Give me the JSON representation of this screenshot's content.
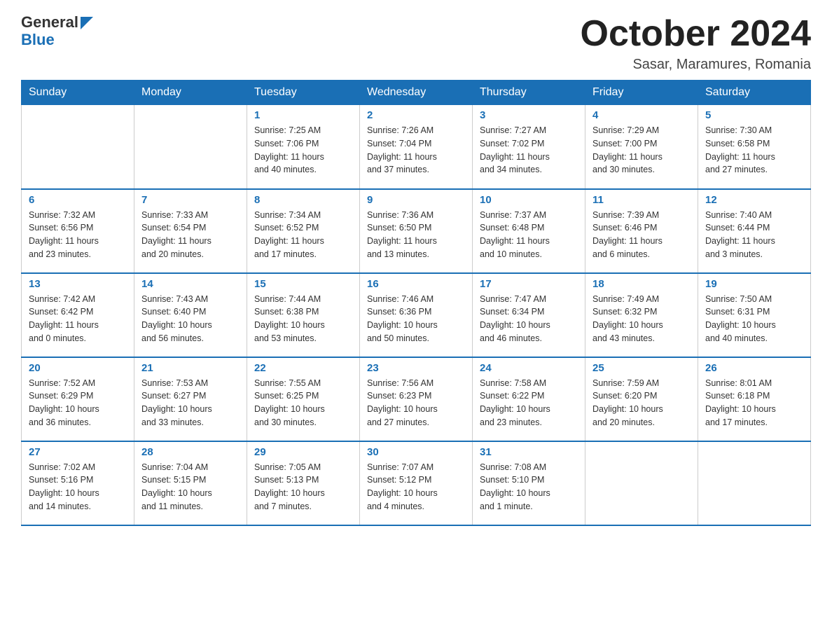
{
  "header": {
    "logo_line1": "General",
    "logo_line2": "Blue",
    "month_title": "October 2024",
    "location": "Sasar, Maramures, Romania"
  },
  "weekdays": [
    "Sunday",
    "Monday",
    "Tuesday",
    "Wednesday",
    "Thursday",
    "Friday",
    "Saturday"
  ],
  "weeks": [
    [
      {
        "day": "",
        "info": ""
      },
      {
        "day": "",
        "info": ""
      },
      {
        "day": "1",
        "info": "Sunrise: 7:25 AM\nSunset: 7:06 PM\nDaylight: 11 hours\nand 40 minutes."
      },
      {
        "day": "2",
        "info": "Sunrise: 7:26 AM\nSunset: 7:04 PM\nDaylight: 11 hours\nand 37 minutes."
      },
      {
        "day": "3",
        "info": "Sunrise: 7:27 AM\nSunset: 7:02 PM\nDaylight: 11 hours\nand 34 minutes."
      },
      {
        "day": "4",
        "info": "Sunrise: 7:29 AM\nSunset: 7:00 PM\nDaylight: 11 hours\nand 30 minutes."
      },
      {
        "day": "5",
        "info": "Sunrise: 7:30 AM\nSunset: 6:58 PM\nDaylight: 11 hours\nand 27 minutes."
      }
    ],
    [
      {
        "day": "6",
        "info": "Sunrise: 7:32 AM\nSunset: 6:56 PM\nDaylight: 11 hours\nand 23 minutes."
      },
      {
        "day": "7",
        "info": "Sunrise: 7:33 AM\nSunset: 6:54 PM\nDaylight: 11 hours\nand 20 minutes."
      },
      {
        "day": "8",
        "info": "Sunrise: 7:34 AM\nSunset: 6:52 PM\nDaylight: 11 hours\nand 17 minutes."
      },
      {
        "day": "9",
        "info": "Sunrise: 7:36 AM\nSunset: 6:50 PM\nDaylight: 11 hours\nand 13 minutes."
      },
      {
        "day": "10",
        "info": "Sunrise: 7:37 AM\nSunset: 6:48 PM\nDaylight: 11 hours\nand 10 minutes."
      },
      {
        "day": "11",
        "info": "Sunrise: 7:39 AM\nSunset: 6:46 PM\nDaylight: 11 hours\nand 6 minutes."
      },
      {
        "day": "12",
        "info": "Sunrise: 7:40 AM\nSunset: 6:44 PM\nDaylight: 11 hours\nand 3 minutes."
      }
    ],
    [
      {
        "day": "13",
        "info": "Sunrise: 7:42 AM\nSunset: 6:42 PM\nDaylight: 11 hours\nand 0 minutes."
      },
      {
        "day": "14",
        "info": "Sunrise: 7:43 AM\nSunset: 6:40 PM\nDaylight: 10 hours\nand 56 minutes."
      },
      {
        "day": "15",
        "info": "Sunrise: 7:44 AM\nSunset: 6:38 PM\nDaylight: 10 hours\nand 53 minutes."
      },
      {
        "day": "16",
        "info": "Sunrise: 7:46 AM\nSunset: 6:36 PM\nDaylight: 10 hours\nand 50 minutes."
      },
      {
        "day": "17",
        "info": "Sunrise: 7:47 AM\nSunset: 6:34 PM\nDaylight: 10 hours\nand 46 minutes."
      },
      {
        "day": "18",
        "info": "Sunrise: 7:49 AM\nSunset: 6:32 PM\nDaylight: 10 hours\nand 43 minutes."
      },
      {
        "day": "19",
        "info": "Sunrise: 7:50 AM\nSunset: 6:31 PM\nDaylight: 10 hours\nand 40 minutes."
      }
    ],
    [
      {
        "day": "20",
        "info": "Sunrise: 7:52 AM\nSunset: 6:29 PM\nDaylight: 10 hours\nand 36 minutes."
      },
      {
        "day": "21",
        "info": "Sunrise: 7:53 AM\nSunset: 6:27 PM\nDaylight: 10 hours\nand 33 minutes."
      },
      {
        "day": "22",
        "info": "Sunrise: 7:55 AM\nSunset: 6:25 PM\nDaylight: 10 hours\nand 30 minutes."
      },
      {
        "day": "23",
        "info": "Sunrise: 7:56 AM\nSunset: 6:23 PM\nDaylight: 10 hours\nand 27 minutes."
      },
      {
        "day": "24",
        "info": "Sunrise: 7:58 AM\nSunset: 6:22 PM\nDaylight: 10 hours\nand 23 minutes."
      },
      {
        "day": "25",
        "info": "Sunrise: 7:59 AM\nSunset: 6:20 PM\nDaylight: 10 hours\nand 20 minutes."
      },
      {
        "day": "26",
        "info": "Sunrise: 8:01 AM\nSunset: 6:18 PM\nDaylight: 10 hours\nand 17 minutes."
      }
    ],
    [
      {
        "day": "27",
        "info": "Sunrise: 7:02 AM\nSunset: 5:16 PM\nDaylight: 10 hours\nand 14 minutes."
      },
      {
        "day": "28",
        "info": "Sunrise: 7:04 AM\nSunset: 5:15 PM\nDaylight: 10 hours\nand 11 minutes."
      },
      {
        "day": "29",
        "info": "Sunrise: 7:05 AM\nSunset: 5:13 PM\nDaylight: 10 hours\nand 7 minutes."
      },
      {
        "day": "30",
        "info": "Sunrise: 7:07 AM\nSunset: 5:12 PM\nDaylight: 10 hours\nand 4 minutes."
      },
      {
        "day": "31",
        "info": "Sunrise: 7:08 AM\nSunset: 5:10 PM\nDaylight: 10 hours\nand 1 minute."
      },
      {
        "day": "",
        "info": ""
      },
      {
        "day": "",
        "info": ""
      }
    ]
  ]
}
